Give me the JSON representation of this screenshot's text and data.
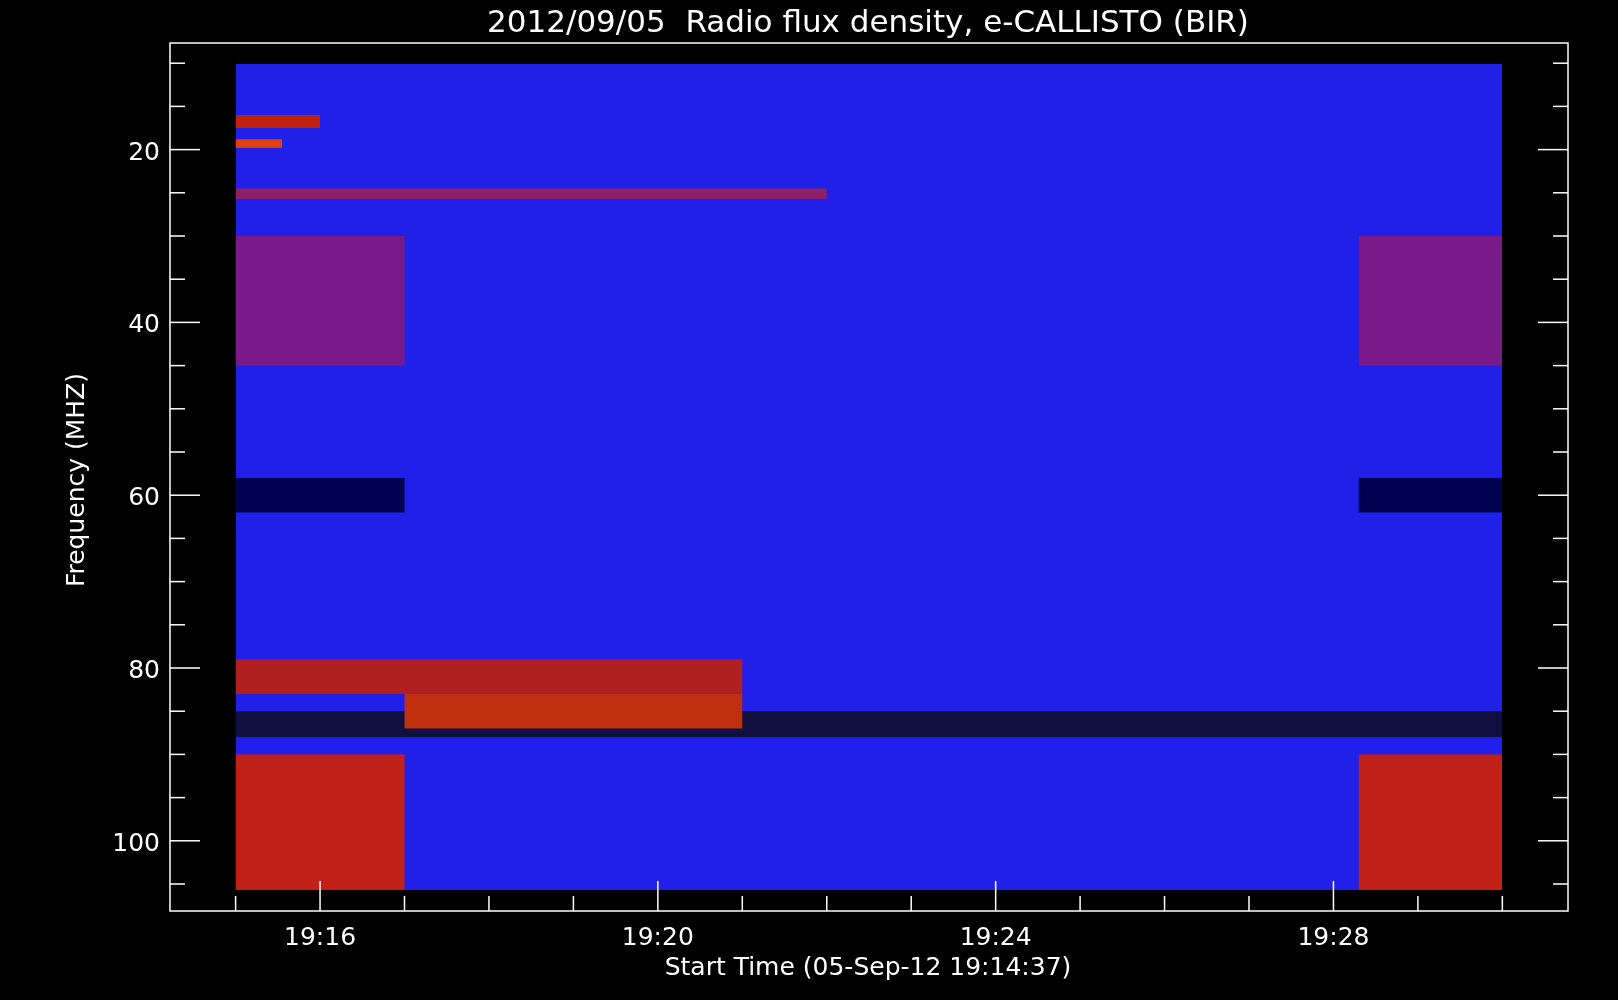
{
  "title": "2012/09/05  Radio flux density, e-CALLISTO (BIR)",
  "y_axis": {
    "label": "Frequency (MHZ)",
    "ticks": [
      "20",
      "40",
      "60",
      "80",
      "100"
    ]
  },
  "x_axis": {
    "label": "Start Time (05-Sep-12 19:14:37)",
    "ticks": [
      "19:16",
      "19:20",
      "19:24",
      "19:28"
    ]
  }
}
